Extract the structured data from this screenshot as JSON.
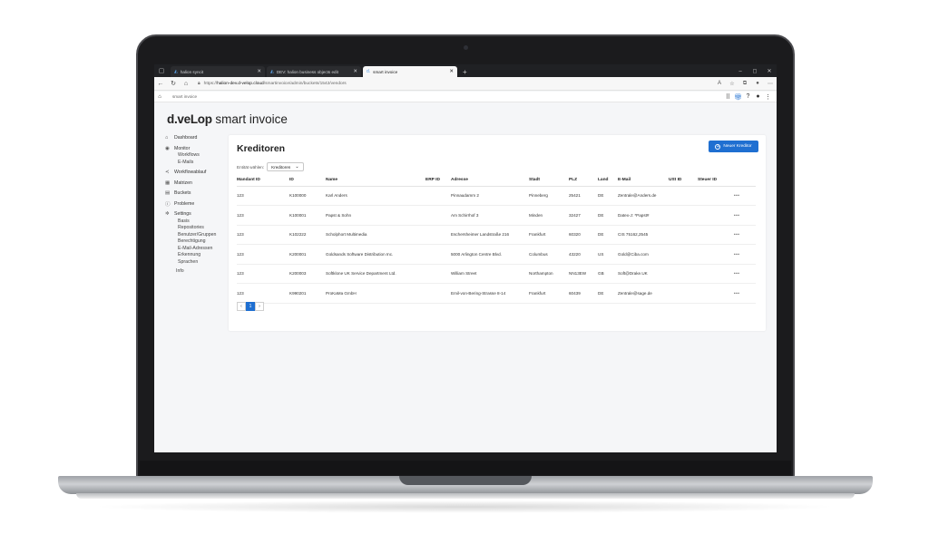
{
  "browser": {
    "tabs": [
      {
        "label": "halion syncit",
        "active": false
      },
      {
        "label": "DEV: halion business objects edit",
        "active": false
      },
      {
        "label": "smart invoice",
        "active": true
      }
    ],
    "url_prefix": "https://",
    "url_host": "halion-dev.d-velop.cloud",
    "url_path": "/smartinvoice/admin/buckets/1542/vendors"
  },
  "app": {
    "breadcrumb": "smart invoice",
    "brand_bold": "d.veLop",
    "brand_rest": " smart invoice"
  },
  "sidebar": {
    "dashboard": "Dashboard",
    "monitor": "Monitor",
    "monitor_sub": [
      "Workflows",
      "E-Mails"
    ],
    "workflowablauf": "Workflowablauf",
    "matrizen": "Matrizen",
    "buckets": "Buckets",
    "probleme": "Probleme",
    "settings": "Settings",
    "settings_sub": [
      "Basis",
      "Repositories",
      "Benutzer/Gruppen",
      "Berechtigung",
      "E-Mail-Adressen",
      "Erkennung",
      "Sprachen"
    ],
    "info": "Info"
  },
  "main": {
    "title": "Kreditoren",
    "new_button": "Neuer Kreditor",
    "entity_label": "Entität wählen:",
    "entity_value": "Kreditoren",
    "columns": [
      "Mandant ID",
      "ID",
      "Name",
      "ERP ID",
      "Adresse",
      "Stadt",
      "PLZ",
      "Land",
      "E-Mail",
      "USt ID",
      "Steuer ID"
    ],
    "rows": [
      {
        "mandant": "123",
        "id": "K100000",
        "name": "Karl Anders",
        "erp": "",
        "adresse": "Pinnaudamm 2",
        "stadt": "Pinneberg",
        "plz": "25421",
        "land": "DE",
        "email": "Zentrale@Anders.de",
        "ust": "",
        "steuer": ""
      },
      {
        "mandant": "123",
        "id": "K100001",
        "name": "Papst & Sohn",
        "erp": "",
        "adresse": "Am Schirrhof 3",
        "stadt": "Minden",
        "plz": "32427",
        "land": "DE",
        "email": "Datex-J: *Papst#",
        "ust": "",
        "steuer": ""
      },
      {
        "mandant": "123",
        "id": "K102222",
        "name": "Scholphort Multimedia",
        "erp": "",
        "adresse": "Eschersheimer Landstraße 216",
        "stadt": "Frankfurt",
        "plz": "60320",
        "land": "DE",
        "email": "CIS 75162,2545",
        "ust": "",
        "steuer": ""
      },
      {
        "mandant": "123",
        "id": "K200001",
        "name": "Goldsands Software Distribution Inc.",
        "erp": "",
        "adresse": "5000 Arlington Centre Blvd.",
        "stadt": "Columbus",
        "plz": "43220",
        "land": "US",
        "email": "Gold@Ciba.com",
        "ust": "",
        "steuer": ""
      },
      {
        "mandant": "123",
        "id": "K200003",
        "name": "Softklone UK Service Department Ltd.",
        "erp": "",
        "adresse": "William Street",
        "stadt": "Northampton",
        "plz": "NN13EW",
        "land": "GB",
        "email": "Soft@Drake.UK",
        "ust": "",
        "steuer": ""
      },
      {
        "mandant": "123",
        "id": "K990201",
        "name": "ProKaMa GmbH",
        "erp": "",
        "adresse": "Emil-von-Bering-Strasse 8-14",
        "stadt": "Frankfurt",
        "plz": "60439",
        "land": "DE",
        "email": "Zentrale@sage.de",
        "ust": "",
        "steuer": ""
      }
    ],
    "row_menu": "•••",
    "pager": {
      "prev": "‹",
      "current": "1",
      "next": "›"
    }
  },
  "colors": {
    "accent": "#1f6fd1"
  }
}
